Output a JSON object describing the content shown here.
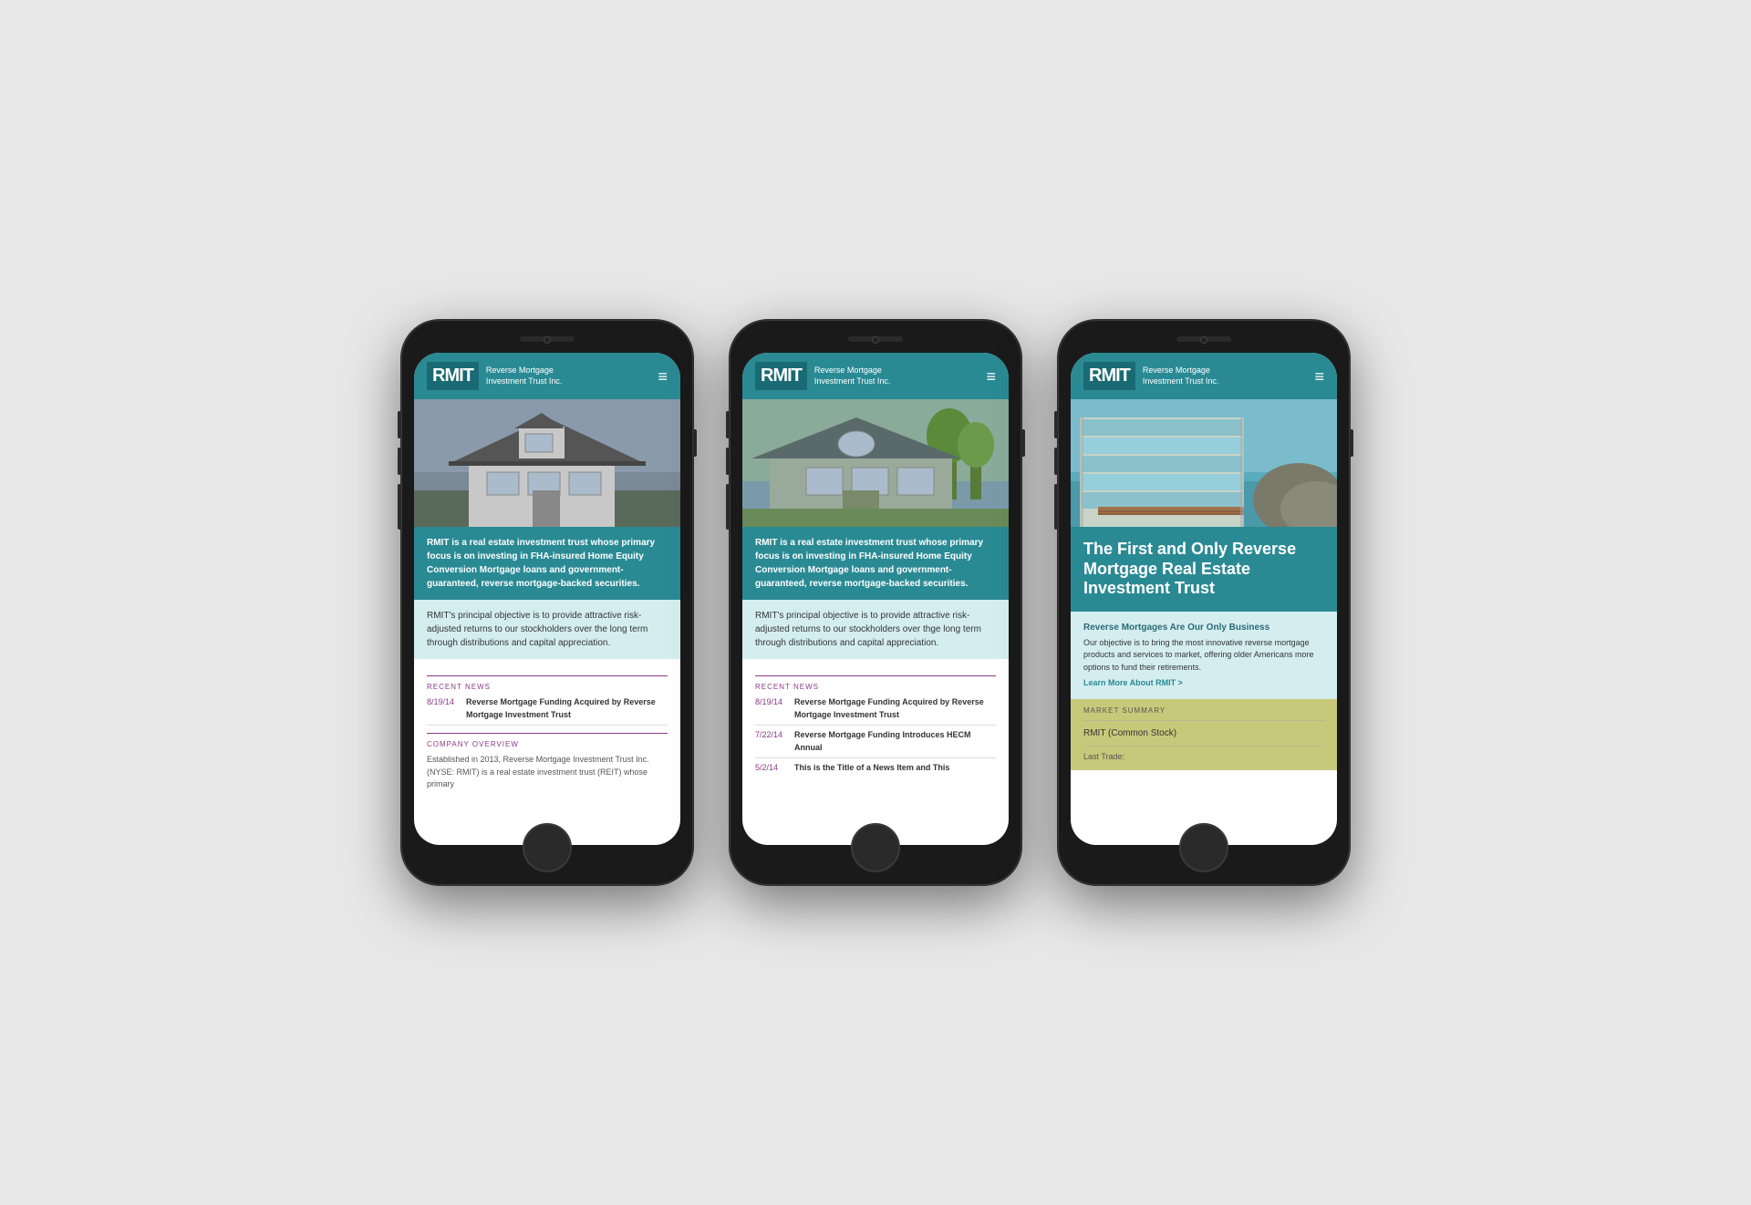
{
  "page": {
    "background": "#e0e0e0"
  },
  "phones": [
    {
      "id": "phone1",
      "header": {
        "logo_text": "RMIT",
        "logo_subtitle": "Reverse Mortgage\nInvestment Trust Inc.",
        "menu_icon": "≡"
      },
      "content_block_1": {
        "text": "RMIT is a real estate investment trust whose primary focus is on investing in FHA-insured Home Equity Conversion Mortgage loans and government-guaranteed, reverse mortgage-backed securities."
      },
      "content_block_2": {
        "text": "RMIT's principal objective is to provide attractive risk-adjusted returns to our stockholders over the long term through distributions and capital appreciation."
      },
      "recent_news": {
        "title": "RECENT NEWS",
        "items": [
          {
            "date": "8/19/14",
            "title": "Reverse Mortgage Funding Acquired by Reverse Mortgage Investment Trust"
          }
        ]
      },
      "company_overview": {
        "title": "COMPANY OVERVIEW",
        "text": "Established in 2013, Reverse Mortgage Investment Trust Inc. (NYSE: RMIT) is a real estate investment trust (REIT) whose primary"
      }
    },
    {
      "id": "phone2",
      "header": {
        "logo_text": "RMIT",
        "logo_subtitle": "Reverse Mortgage\nInvestment Trust Inc.",
        "menu_icon": "≡"
      },
      "content_block_1": {
        "text": "RMIT is a real estate investment trust whose primary focus is on investing in FHA-insured Home Equity Conversion Mortgage loans and government-guaranteed, reverse mortgage-backed securities."
      },
      "content_block_2": {
        "text": "RMIT's principal objective is to provide attractive risk-adjusted returns to our stockholders over thge long term through distributions and capital appreciation."
      },
      "recent_news": {
        "title": "RECENT NEWS",
        "items": [
          {
            "date": "8/19/14",
            "title": "Reverse Mortgage Funding Acquired by Reverse Mortgage Investment Trust"
          },
          {
            "date": "7/22/14",
            "title": "Reverse Mortgage Funding Introduces HECM Annual"
          },
          {
            "date": "5/2/14",
            "title": "This is the Title of a News Item and This"
          }
        ]
      }
    },
    {
      "id": "phone3",
      "header": {
        "logo_text": "RMIT",
        "logo_subtitle": "Reverse Mortgage\nInvestment Trust Inc.",
        "menu_icon": "≡"
      },
      "hero_title": "The First and Only Reverse Mortgage Real Estate Investment Trust",
      "info_block": {
        "title": "Reverse Mortgages Are Our Only Business",
        "text": "Our objective is to bring the most innovative reverse mortgage products and services to market, offering older Americans more options to fund their retirements.",
        "link": "Learn More About RMIT >"
      },
      "market_summary": {
        "title": "MARKET SUMMARY",
        "stock_name": "RMIT (Common Stock)",
        "last_trade_label": "Last Trade:"
      }
    }
  ]
}
